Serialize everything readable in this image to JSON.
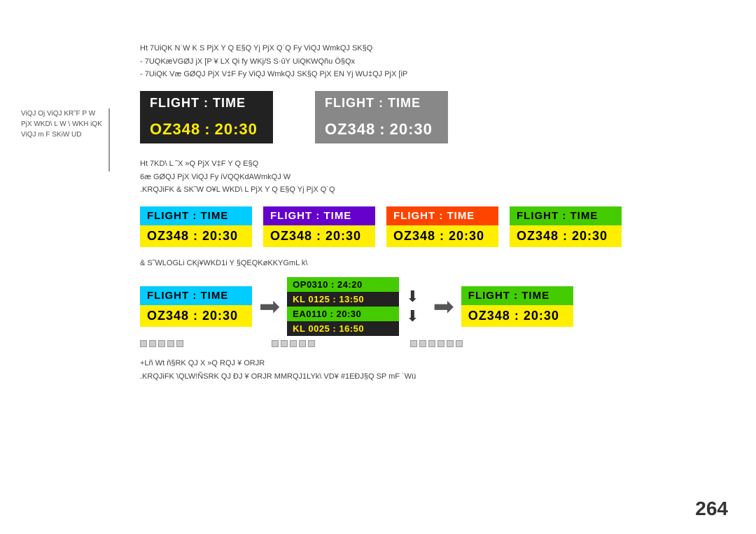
{
  "page": {
    "number": "264"
  },
  "sidebar": {
    "text": "ViQJ  Oj    ViQJ KR˜F\nP W PjX WKD\\ L W \\ WKH\niQK ViQJ m F SKiW UD"
  },
  "main_title": {
    "line1": "Ht  7UiQK N˙W K S PjX Y Q E§Q Yj PjX Q˙Q Fy    ViQJ WmkQJ SK§Q",
    "bullet1": "- 7UQKæVGØJ jX [P ¥ LX Qi fy WKj/S S·ûY UiQKWQñu Ö§Qx",
    "bullet2": "- 7UiQK Væ GØQJ PjX V‡F Fy    ViQJ WmkQJ SK§Q PjX EN Yj WU‡QJ PjX [iP"
  },
  "large_boards": [
    {
      "id": "dark",
      "theme": "dark",
      "header": "FLIGHT  :  TIME",
      "flight": "OZ348",
      "time": "20:30"
    },
    {
      "id": "gray",
      "theme": "gray",
      "header": "FLIGHT  :  TIME",
      "flight": "OZ348",
      "time": "20:30"
    }
  ],
  "sub_title": {
    "line1": "Ht  7KD\\  L  ˜X  »Q PjX V‡F Y Q E§Q",
    "line2": "6æ  GØQJ PjX ViQJ Fy  iVQQKdAWmkQJ W",
    "line3": ".KRQJiFK  &    SK˜W O¥L WKD\\  L PjX Y Q E§Q Yj PjX Q˙Q"
  },
  "small_boards": [
    {
      "theme": "cyan",
      "header": "FLIGHT  :  TIME",
      "flight": "OZ348",
      "time": "20:30"
    },
    {
      "theme": "purple",
      "header": "FLIGHT  :  TIME",
      "flight": "OZ348",
      "time": "20:30"
    },
    {
      "theme": "orange",
      "header": "FLIGHT  :  TIME",
      "flight": "OZ348",
      "time": "20:30"
    },
    {
      "theme": "green",
      "header": "FLIGHT  :  TIME",
      "flight": "OZ348",
      "time": "20:30"
    }
  ],
  "flow_section": {
    "note": "&    S˜WLOGLi CKj¥WKD1i Y  §QEQKøKKYGmL  k\\",
    "left_board": {
      "theme": "cyan",
      "header": "FLIGHT  :  TIME",
      "flight": "OZ348",
      "time": "20:30"
    },
    "multi_flights": [
      {
        "cls": "op",
        "text": "OP0310 :  24:20"
      },
      {
        "cls": "kl1",
        "text": "KL 0125 :  13:50"
      },
      {
        "cls": "ea",
        "text": "EA0110 :  20:30"
      },
      {
        "cls": "kl2",
        "text": "KL 0025 :  16:50"
      }
    ],
    "right_board": {
      "theme": "green",
      "header": "FLIGHT  :  TIME",
      "flight": "OZ348",
      "time": "20:30"
    },
    "captions": [
      {
        "squares": 5,
        "label": ""
      },
      {
        "squares": 5,
        "label": ""
      },
      {
        "squares": 6,
        "label": ""
      }
    ]
  },
  "bottom_text": {
    "line1": "+Lñ Wt ñ§RK QJ X »Q RQJ ¥ ORJR",
    "line2": ".KRQJiFK  \\QLW!ÑSRK QJ ÐJ ¥ ORJR MMRQJ1LYk\\ VD¥ #1EÐJ§Q SP mF  ˙Wü"
  }
}
